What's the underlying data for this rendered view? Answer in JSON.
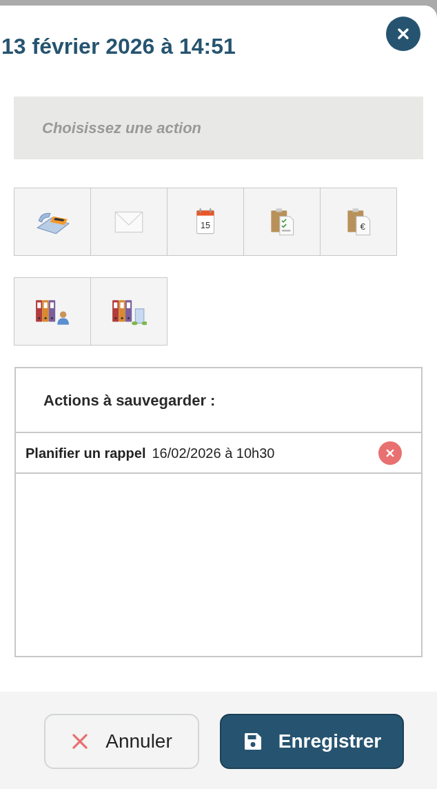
{
  "title": "13 février 2026 à 14:51",
  "select": {
    "placeholder": "Choisissez une action"
  },
  "actions": [
    {
      "kind": "phone"
    },
    {
      "kind": "mail"
    },
    {
      "kind": "calendar",
      "icon_text": "15"
    },
    {
      "kind": "task-list"
    },
    {
      "kind": "invoice",
      "icon_text": "€"
    },
    {
      "kind": "folders-person"
    },
    {
      "kind": "folders-building"
    }
  ],
  "pending": {
    "heading": "Actions à sauvegarder :",
    "items": [
      {
        "label": "Planifier un rappel",
        "detail": "16/02/2026 à 10h30"
      }
    ]
  },
  "buttons": [
    {
      "kind": "cancel",
      "label": "Annuler"
    },
    {
      "kind": "save",
      "label": "Enregistrer"
    }
  ]
}
